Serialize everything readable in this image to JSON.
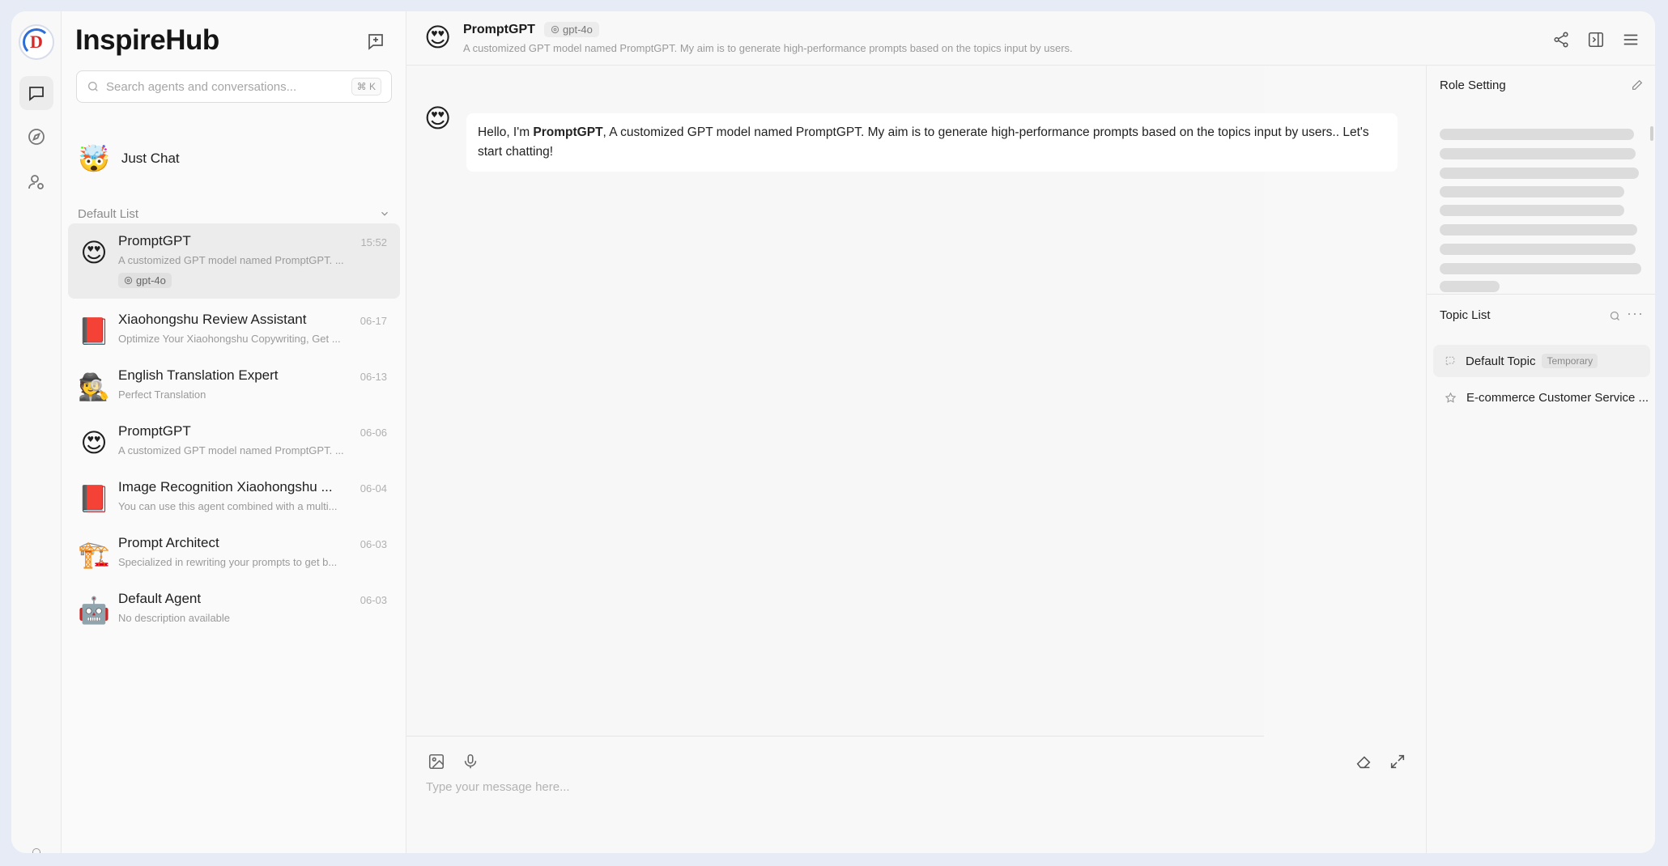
{
  "app": {
    "brand": "InspireHub",
    "logo_letter": "D"
  },
  "search": {
    "placeholder": "Search agents and conversations...",
    "shortcut": "⌘ K"
  },
  "just_chat": {
    "label": "Just Chat",
    "emoji": "🤯"
  },
  "group": {
    "label": "Default List"
  },
  "sessions": [
    {
      "title": "PromptGPT",
      "desc": "A customized GPT model named PromptGPT. ...",
      "time": "15:52",
      "tag": "gpt-4o",
      "emoji": "😍"
    },
    {
      "title": "Xiaohongshu Review Assistant",
      "desc": "Optimize Your Xiaohongshu Copywriting, Get ...",
      "time": "06-17",
      "emoji": "📕"
    },
    {
      "title": "English Translation Expert",
      "desc": "Perfect Translation",
      "time": "06-13",
      "emoji": "🕵️"
    },
    {
      "title": "PromptGPT",
      "desc": "A customized GPT model named PromptGPT. ...",
      "time": "06-06",
      "emoji": "😍"
    },
    {
      "title": "Image Recognition Xiaohongshu ...",
      "desc": "You can use this agent combined with a multi...",
      "time": "06-04",
      "emoji": "📕"
    },
    {
      "title": "Prompt Architect",
      "desc": "Specialized in rewriting your prompts to get b...",
      "time": "06-03",
      "emoji": "🏗️"
    },
    {
      "title": "Default Agent",
      "desc": "No description available",
      "time": "06-03",
      "emoji": "🤖"
    }
  ],
  "header": {
    "name": "PromptGPT",
    "model": "gpt-4o",
    "subtitle": "A customized GPT model named PromptGPT. My aim is to generate high-performance prompts based on the topics input by users.",
    "emoji": "😍"
  },
  "message": {
    "prefix": "Hello, I'm ",
    "bold": "PromptGPT",
    "suffix": ", A customized GPT model named PromptGPT. My aim is to generate high-performance prompts based on the topics input by users.. Let's start chatting!",
    "emoji": "😍"
  },
  "composer": {
    "placeholder": "Type your message here..."
  },
  "right_panel": {
    "role_title": "Role Setting",
    "topic_title": "Topic List",
    "topics": [
      {
        "label": "Default Topic",
        "badge": "Temporary"
      },
      {
        "label": "E-commerce Customer Service ..."
      }
    ]
  },
  "colors": {
    "accent_red": "#d62b2b",
    "accent_blue": "#2d6fd6",
    "skeleton": "#dcdcdc"
  }
}
